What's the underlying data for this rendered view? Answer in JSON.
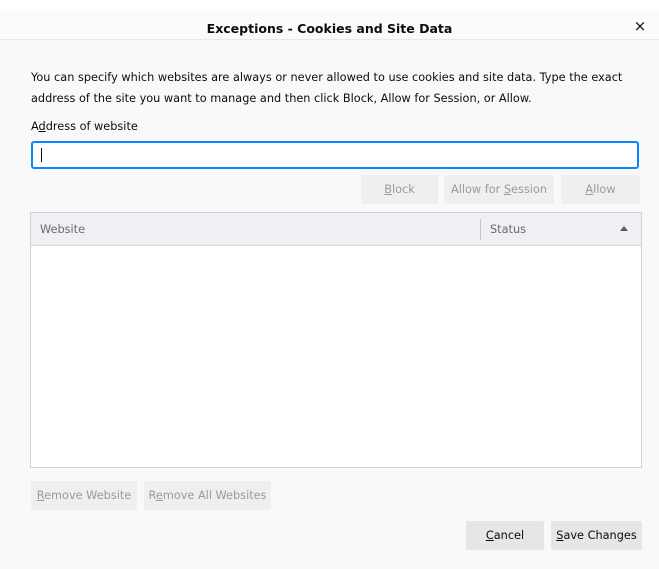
{
  "dialog": {
    "title": "Exceptions - Cookies and Site Data",
    "close_glyph": "×",
    "description": "You can specify which websites are always or never allowed to use cookies and site data. Type the exact address of the site you want to manage and then click Block, Allow for Session, or Allow.",
    "address_label_pre": "A",
    "address_label_key": "d",
    "address_label_post": "dress of website",
    "address_value": "",
    "address_placeholder": ""
  },
  "actions": {
    "block_key": "B",
    "block_rest": "lock",
    "session_pre": "Allow for ",
    "session_key": "S",
    "session_rest": "ession",
    "allow_key": "A",
    "allow_rest": "llow"
  },
  "table": {
    "columns": [
      "Website",
      "Status"
    ],
    "sort_icon": "sort-ascending-icon",
    "rows": []
  },
  "removal": {
    "remove_key": "R",
    "remove_rest": "emove Website",
    "remove_all_pre": "R",
    "remove_all_key": "e",
    "remove_all_rest": "move All Websites"
  },
  "footer": {
    "cancel_key": "C",
    "cancel_rest": "ancel",
    "save_key": "S",
    "save_rest": "ave Changes"
  },
  "colors": {
    "focus": "#0a84ff",
    "button_bg": "#ebebeb",
    "disabled_text": "#9a9a9a"
  }
}
